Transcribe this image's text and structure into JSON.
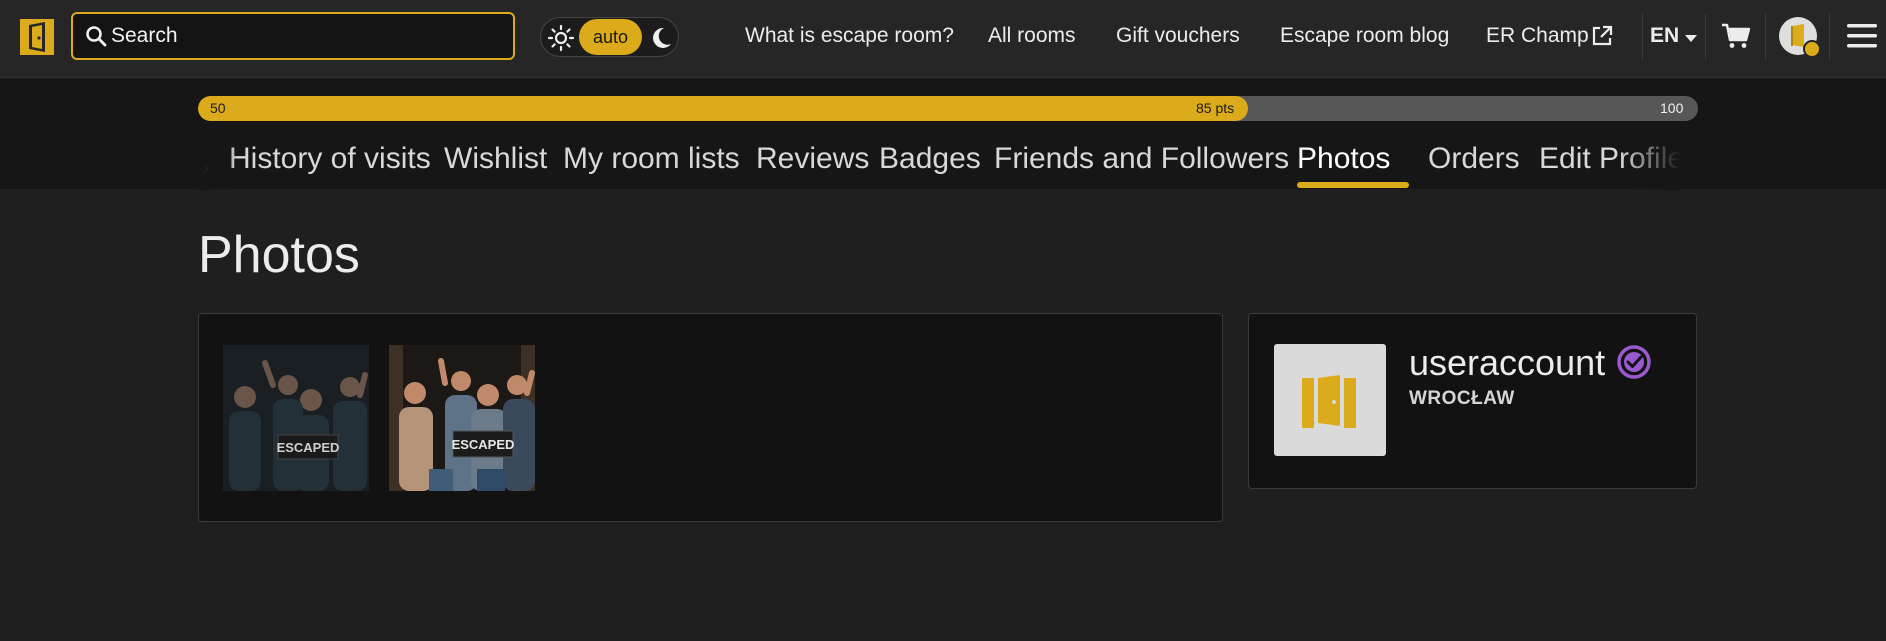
{
  "search": {
    "placeholder": "Search"
  },
  "theme": {
    "mode_label": "auto"
  },
  "nav": {
    "links": [
      "What is escape room?",
      "All rooms",
      "Gift vouchers",
      "Escape room blog",
      "ER Champ"
    ],
    "language": "EN"
  },
  "progress": {
    "min_label": "50",
    "current_label": "85 pts",
    "max_label": "100",
    "min": 50,
    "value": 85,
    "max": 100
  },
  "tabs": [
    "History of visits",
    "Wishlist",
    "My room lists",
    "Reviews",
    "Badges",
    "Friends and Followers",
    "Photos",
    "Orders",
    "Edit Profile"
  ],
  "active_tab": "Photos",
  "page": {
    "title": "Photos"
  },
  "photos": [
    {
      "sign_text": "ESCAPED"
    },
    {
      "sign_text": "ESCAPED"
    }
  ],
  "profile": {
    "username": "useraccount",
    "city": "WROCŁAW"
  },
  "colors": {
    "accent": "#dcab1b",
    "verified": "#9b59d0",
    "background": "#1f1f1f"
  },
  "icons": {
    "logo": "door-logo-icon",
    "search": "search-icon",
    "sun": "sun-icon",
    "moon": "moon-icon",
    "external": "external-link-icon",
    "cart": "cart-icon",
    "menu": "hamburger-icon",
    "verified": "verified-badge-icon"
  }
}
